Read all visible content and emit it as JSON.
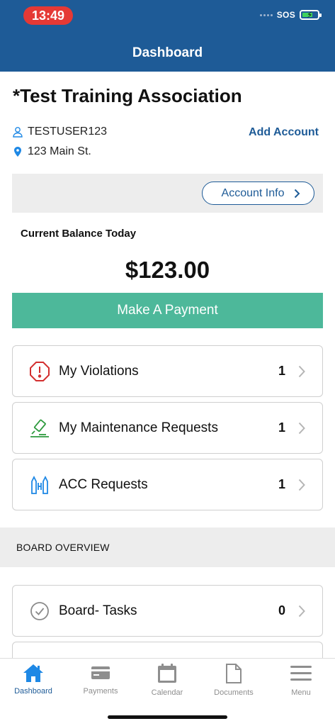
{
  "status": {
    "time": "13:49",
    "sos": "SOS"
  },
  "header": {
    "title": "Dashboard"
  },
  "association": {
    "name": "*Test Training Association",
    "user": "TESTUSER123",
    "address": "123 Main St.",
    "add_account": "Add Account",
    "account_info": "Account Info"
  },
  "balance": {
    "label": "Current Balance Today",
    "amount": "$123.00"
  },
  "payment_button": "Make A Payment",
  "cards": [
    {
      "label": "My Violations",
      "count": "1"
    },
    {
      "label": "My Maintenance Requests",
      "count": "1"
    },
    {
      "label": "ACC Requests",
      "count": "1"
    }
  ],
  "board": {
    "section_title": "BOARD OVERVIEW",
    "cards": [
      {
        "label": "Board- Tasks",
        "count": "0"
      }
    ]
  },
  "tabs": [
    {
      "label": "Dashboard",
      "icon": "home-icon"
    },
    {
      "label": "Payments",
      "icon": "credit-card-icon"
    },
    {
      "label": "Calendar",
      "icon": "calendar-icon"
    },
    {
      "label": "Documents",
      "icon": "document-icon"
    },
    {
      "label": "Menu",
      "icon": "menu-icon"
    }
  ],
  "colors": {
    "brand": "#1e5b97",
    "pay_button": "#4db89a",
    "violation": "#d32f2f",
    "maintenance": "#2e9a3e",
    "acc": "#1e88e5",
    "active_tab": "#1e5b97"
  }
}
